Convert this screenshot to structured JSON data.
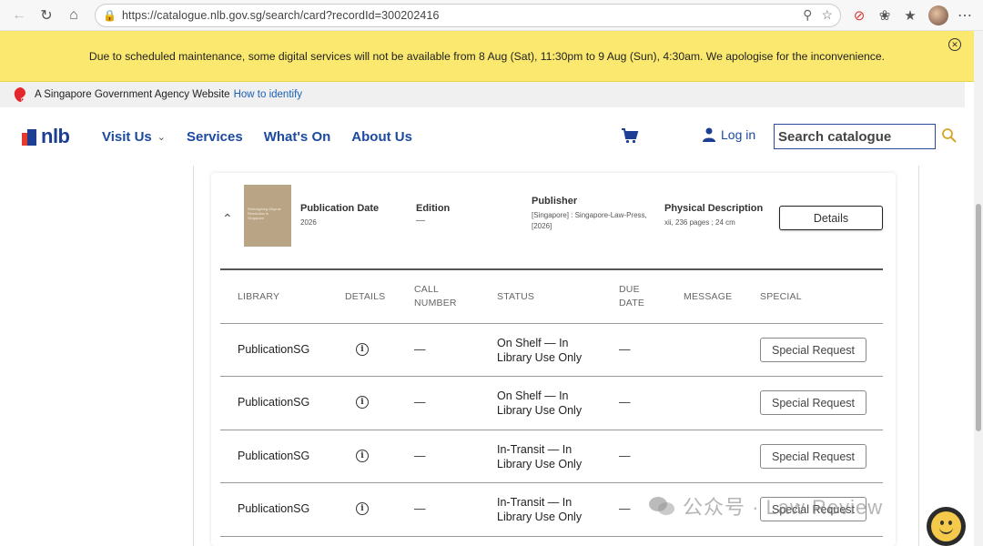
{
  "browser": {
    "url": "https://catalogue.nlb.gov.sg/search/card?recordId=300202416"
  },
  "banner": {
    "message": "Due to scheduled maintenance, some digital services will not be available from 8 Aug (Sat), 11:30pm to 9 Aug (Sun), 4:30am. We apologise for the inconvenience."
  },
  "gov_strip": {
    "text": "A Singapore Government Agency Website",
    "link": "How to identify"
  },
  "header": {
    "logo": "nlb",
    "nav": [
      "Visit Us",
      "Services",
      "What's On",
      "About Us"
    ],
    "login": "Log in",
    "search_placeholder": "Search catalogue"
  },
  "record": {
    "cover_text": "Reimagining Dispute Resolution in Singapore",
    "publication_date_label": "Publication Date",
    "publication_date": "2026",
    "edition_label": "Edition",
    "edition": "—",
    "publisher_label": "Publisher",
    "publisher_line1": "[Singapore] : Singapore-Law-Press,",
    "publisher_line2": "[2026]",
    "physical_label": "Physical Description",
    "physical": "xii, 236 pages ; 24 cm",
    "details_button": "Details"
  },
  "table": {
    "headers": {
      "library": "LIBRARY",
      "details": "DETAILS",
      "call_number_1": "CALL",
      "call_number_2": "NUMBER",
      "status": "STATUS",
      "due_1": "DUE",
      "due_2": "DATE",
      "message": "MESSAGE",
      "special": "SPECIAL"
    },
    "rows": [
      {
        "library": "PublicationSG",
        "call": "—",
        "status1": "On Shelf — In",
        "status2": "Library Use Only",
        "due": "—",
        "button": "Special Request"
      },
      {
        "library": "PublicationSG",
        "call": "—",
        "status1": "On Shelf — In",
        "status2": "Library Use Only",
        "due": "—",
        "button": "Special Request"
      },
      {
        "library": "PublicationSG",
        "call": "—",
        "status1": "In-Transit — In",
        "status2": "Library Use Only",
        "due": "—",
        "button": "Special Request"
      },
      {
        "library": "PublicationSG",
        "call": "—",
        "status1": "In-Transit — In",
        "status2": "Library Use Only",
        "due": "—",
        "button": "Special Request"
      }
    ]
  },
  "watermark": {
    "text": "公众号 · Law Review"
  },
  "colors": {
    "banner": "#fbe96f",
    "nav_blue": "#1c4aa0",
    "logo_red": "#e63a2e",
    "logo_blue": "#1c3f94"
  }
}
